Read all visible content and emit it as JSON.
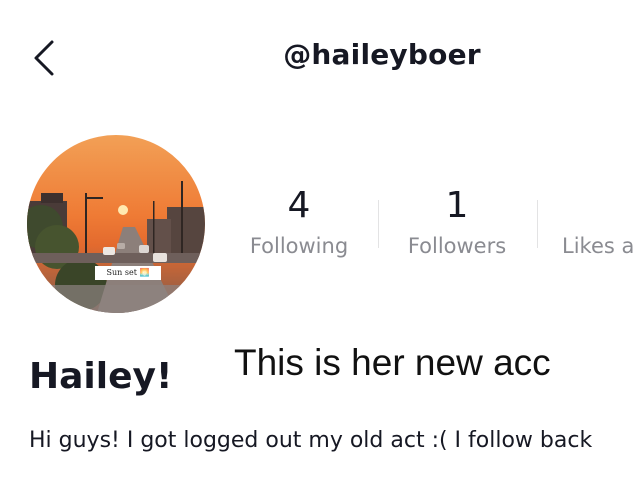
{
  "header": {
    "back_icon": "chevron-left-icon",
    "username": "@haileyboer"
  },
  "profile": {
    "avatar_caption": "Sun set 🌅",
    "display_name": "Hailey!",
    "bio": "Hi guys! I got logged out my old act :( I follow back"
  },
  "stats": {
    "following": {
      "value": "4",
      "label": "Following"
    },
    "followers": {
      "value": "1",
      "label": "Followers"
    },
    "likes": {
      "label": "Likes a"
    }
  },
  "overlay": {
    "caption": "This is her new acc"
  },
  "colors": {
    "primary_text": "#161823",
    "secondary_text": "#8a8b91",
    "divider": "#e3e3e4",
    "background": "#ffffff"
  }
}
